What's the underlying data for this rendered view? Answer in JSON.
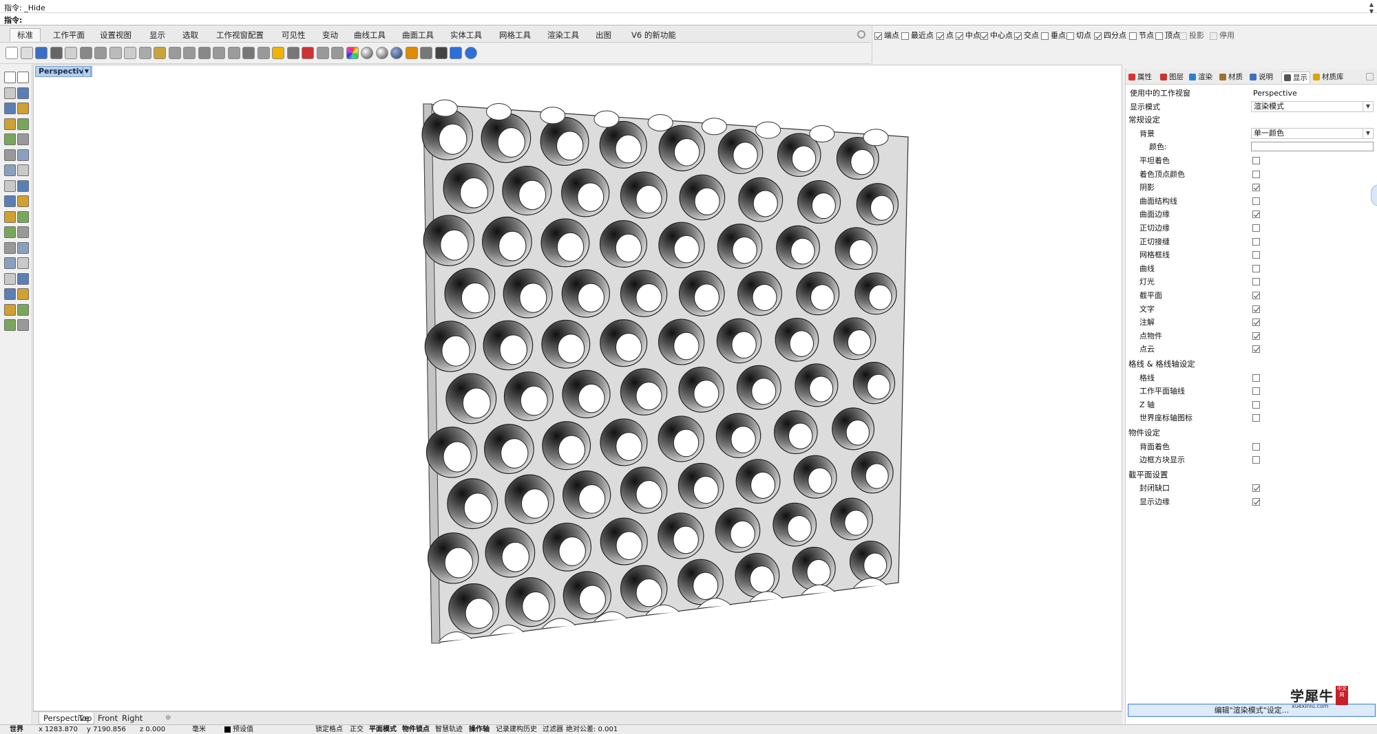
{
  "command": {
    "history": "指令: _Hide",
    "prompt": "指令:"
  },
  "toolbar_tabs": [
    "标准",
    "工作平面",
    "设置视图",
    "显示",
    "选取",
    "工作视窗配置",
    "可见性",
    "变动",
    "曲线工具",
    "曲面工具",
    "实体工具",
    "网格工具",
    "渲染工具",
    "出图",
    "V6 的新功能"
  ],
  "osnaps": [
    {
      "label": "端点",
      "checked": true
    },
    {
      "label": "最近点",
      "checked": false
    },
    {
      "label": "点",
      "checked": true
    },
    {
      "label": "中点",
      "checked": true
    },
    {
      "label": "中心点",
      "checked": true
    },
    {
      "label": "交点",
      "checked": true
    },
    {
      "label": "垂点",
      "checked": false
    },
    {
      "label": "切点",
      "checked": false
    },
    {
      "label": "四分点",
      "checked": true
    },
    {
      "label": "节点",
      "checked": false
    },
    {
      "label": "顶点",
      "checked": false
    },
    {
      "label": "投影",
      "checked": false
    },
    {
      "label": "停用",
      "checked": false
    }
  ],
  "viewport": {
    "title": "Perspective",
    "tabs": [
      "Perspective",
      "Top",
      "Front",
      "Right"
    ]
  },
  "panel": {
    "tabs": [
      "属性",
      "图层",
      "渲染",
      "材质",
      "说明",
      "显示",
      "材质库"
    ],
    "active_tab": "显示",
    "viewport_label": "使用中的工作视窗",
    "viewport_value": "Perspective",
    "display_mode_label": "显示模式",
    "display_mode_value": "渲染模式",
    "section_general": "常规设定",
    "background_label": "背景",
    "background_value": "单一颜色",
    "color_label": "颜色:",
    "general_options": [
      {
        "label": "平坦着色",
        "checked": false
      },
      {
        "label": "着色顶点颜色",
        "checked": false
      },
      {
        "label": "阴影",
        "checked": true
      },
      {
        "label": "曲面结构线",
        "checked": false
      },
      {
        "label": "曲面边缘",
        "checked": true
      },
      {
        "label": "正切边缘",
        "checked": false
      },
      {
        "label": "正切接缝",
        "checked": false
      },
      {
        "label": "网格框线",
        "checked": false
      },
      {
        "label": "曲线",
        "checked": false
      },
      {
        "label": "灯光",
        "checked": false
      },
      {
        "label": "截平面",
        "checked": true
      },
      {
        "label": "文字",
        "checked": true
      },
      {
        "label": "注解",
        "checked": true
      },
      {
        "label": "点物件",
        "checked": true
      },
      {
        "label": "点云",
        "checked": true
      }
    ],
    "section_grid": "格线 & 格线轴设定",
    "grid_options": [
      {
        "label": "格线",
        "checked": false
      },
      {
        "label": "工作平面轴线",
        "checked": false
      },
      {
        "label": "Z 轴",
        "checked": false
      },
      {
        "label": "世界座标轴图标",
        "checked": false
      }
    ],
    "section_object": "物件设定",
    "object_options": [
      {
        "label": "背面着色",
        "checked": false
      },
      {
        "label": "边框方块显示",
        "checked": false
      }
    ],
    "section_clipping": "截平面设置",
    "clipping_options": [
      {
        "label": "封闭缺口",
        "checked": true
      },
      {
        "label": "显示边缘",
        "checked": true
      }
    ],
    "edit_button": "编辑\"渲染模式\"设定..."
  },
  "status": {
    "cplane": "世界",
    "x": "x 1283.870",
    "y": "y 7190.856",
    "z": "z 0.000",
    "unit": "毫米",
    "layer": "预设值",
    "toggles": [
      "锁定格点",
      "正交",
      "平面模式",
      "物件锁点",
      "智慧轨迹",
      "操作轴",
      "记录建构历史",
      "过滤器"
    ],
    "bold_toggles": [
      "平面模式",
      "物件锁点",
      "操作轴"
    ],
    "tolerance": "绝对公差: 0.001"
  },
  "watermark": {
    "main": "学犀牛",
    "sub": "xuexiniu.com",
    "seal": "中文网"
  },
  "colors": {
    "viewport_title_bg": "#b8cfe9",
    "edit_button_border": "#3d7bd9",
    "seal": "#c8202a"
  }
}
